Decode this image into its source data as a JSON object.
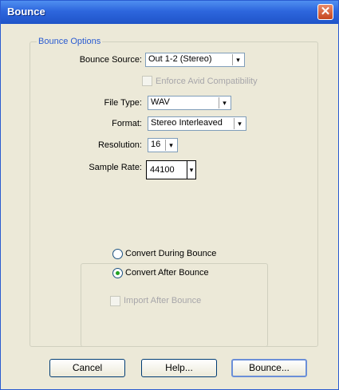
{
  "window": {
    "title": "Bounce",
    "close_glyph": "✕"
  },
  "group": {
    "legend": "Bounce Options"
  },
  "fields": {
    "bounce_source": {
      "label": "Bounce Source:",
      "value": "Out 1-2 (Stereo)"
    },
    "enforce_avid": {
      "label": "Enforce Avid Compatibility",
      "checked": false,
      "enabled": false
    },
    "file_type": {
      "label": "File Type:",
      "value": "WAV"
    },
    "format": {
      "label": "Format:",
      "value": "Stereo Interleaved"
    },
    "resolution": {
      "label": "Resolution:",
      "value": "16"
    },
    "sample_rate": {
      "label": "Sample Rate:",
      "value": "44100"
    }
  },
  "convert": {
    "during_label": "Convert During Bounce",
    "after_label": "Convert After Bounce",
    "selected": "after",
    "import_after_label": "Import After Bounce"
  },
  "buttons": {
    "cancel": "Cancel",
    "help": "Help...",
    "bounce": "Bounce..."
  },
  "icons": {
    "dropdown": "▾"
  },
  "colors": {
    "titlebar": "#2d66dd",
    "legend": "#2a5bd1",
    "radio_dot": "#21a121"
  }
}
